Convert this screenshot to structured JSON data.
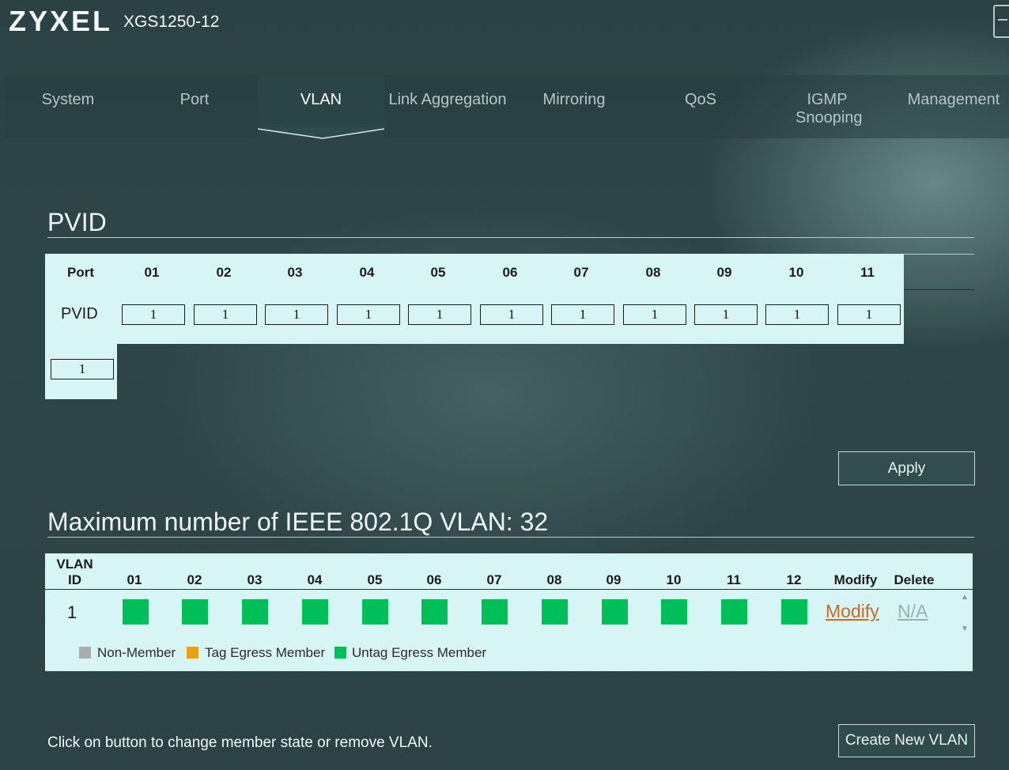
{
  "header": {
    "brand": "ZYXEL",
    "model": "XGS1250-12"
  },
  "nav": {
    "tabs": [
      {
        "label": "System",
        "active": false
      },
      {
        "label": "Port",
        "active": false
      },
      {
        "label": "VLAN",
        "active": true
      },
      {
        "label": "Link Aggregation",
        "active": false
      },
      {
        "label": "Mirroring",
        "active": false
      },
      {
        "label": "QoS",
        "active": false
      },
      {
        "label": "IGMP Snooping",
        "active": false
      },
      {
        "label": "Management",
        "active": false
      }
    ]
  },
  "pvid": {
    "title": "PVID",
    "port_header": "Port",
    "pvid_label": "PVID",
    "ports": [
      "01",
      "02",
      "03",
      "04",
      "05",
      "06",
      "07",
      "08",
      "09",
      "10",
      "11"
    ],
    "values": [
      "1",
      "1",
      "1",
      "1",
      "1",
      "1",
      "1",
      "1",
      "1",
      "1",
      "1",
      "1"
    ],
    "apply_label": "Apply"
  },
  "vlan": {
    "title": "Maximum number of IEEE 802.1Q VLAN: 32",
    "id_header": "VLAN ID",
    "ports": [
      "01",
      "02",
      "03",
      "04",
      "05",
      "06",
      "07",
      "08",
      "09",
      "10",
      "11",
      "12"
    ],
    "modify_header": "Modify",
    "delete_header": "Delete",
    "rows": [
      {
        "id": "1",
        "members": [
          "untag",
          "untag",
          "untag",
          "untag",
          "untag",
          "untag",
          "untag",
          "untag",
          "untag",
          "untag",
          "untag",
          "untag"
        ],
        "modify": "Modify",
        "delete": "N/A"
      }
    ],
    "legend": [
      {
        "label": "Non-Member",
        "color": "#a7aeae"
      },
      {
        "label": "Tag Egress Member",
        "color": "#e8a11a"
      },
      {
        "label": "Untag Egress Member",
        "color": "#00bf58"
      }
    ],
    "create_label": "Create New VLAN",
    "hint": "Click on button to change member state or remove VLAN."
  }
}
